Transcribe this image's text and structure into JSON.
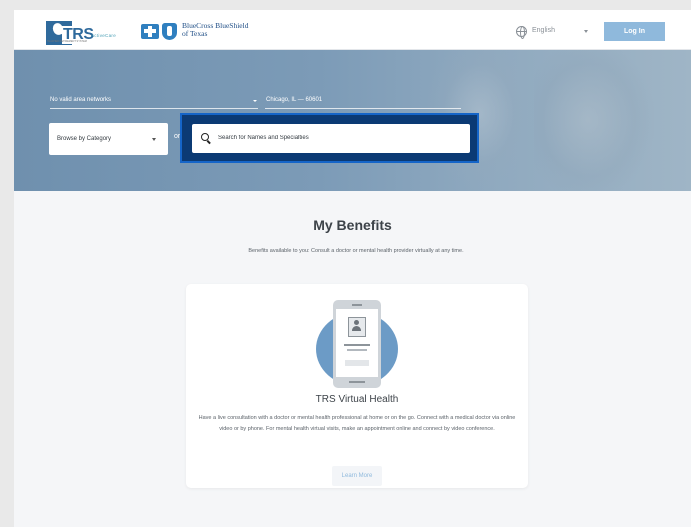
{
  "header": {
    "trs_logo_text": "TRS",
    "trs_logo_sub": "ActiveCare",
    "trs_logo_small": "TEACHER RETIREMENT SYSTEM",
    "bcbs_name_line1": "BlueCross BlueShield",
    "bcbs_name_line2": "of Texas",
    "language": "English",
    "login_label": "Log In"
  },
  "hero": {
    "network_value": "No valid area networks",
    "location_value": "Chicago, IL — 60601",
    "category_label": "Browse by Category",
    "or_label": "or",
    "search_placeholder": "Search for Names and Specialties"
  },
  "benefits": {
    "title": "My Benefits",
    "subtitle": "Benefits available to you: Consult a doctor or mental health provider virtually at any time.",
    "card": {
      "title": "TRS Virtual Health",
      "description": "Have a live consultation with a doctor or mental health professional at home or on the go. Connect with a medical doctor via online video or by phone. For mental health virtual visits, make an appointment online and connect by video conference.",
      "button_label": "Learn More"
    }
  },
  "colors": {
    "brand_blue": "#2f6a9c",
    "login_button": "#8fb9dc",
    "hero_bg": "#7c9bb7",
    "search_focus": "#0b3a74",
    "illustration_circle": "#6c9bc6"
  }
}
